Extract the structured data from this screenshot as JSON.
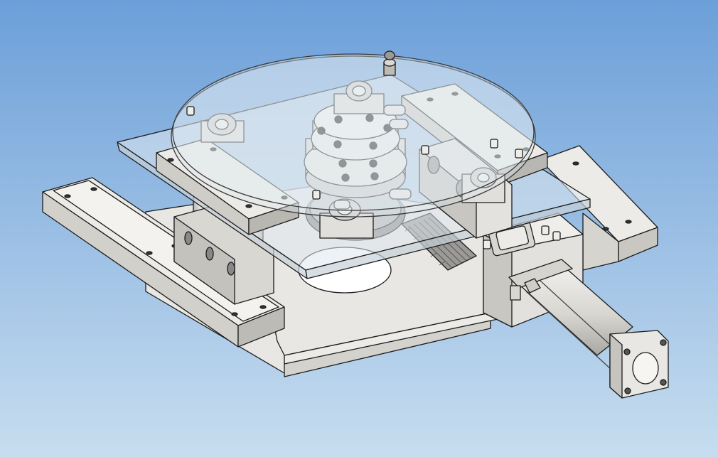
{
  "viewport": {
    "background_top": "#6c9fd9",
    "background_bottom": "#c7ddef"
  },
  "model": {
    "part_fill": "#e6e5e1",
    "part_shade": "#c9c7c2",
    "part_dark": "#9c9a96",
    "edge_color": "#1c1c1c",
    "glass_fill": "#dfe8ef",
    "glass_edge": "#3a3a3a",
    "rack_color": "#555555",
    "icons": [
      "rotary-table-icon",
      "pneumatic-cylinder-icon",
      "gear-rack-icon"
    ]
  }
}
